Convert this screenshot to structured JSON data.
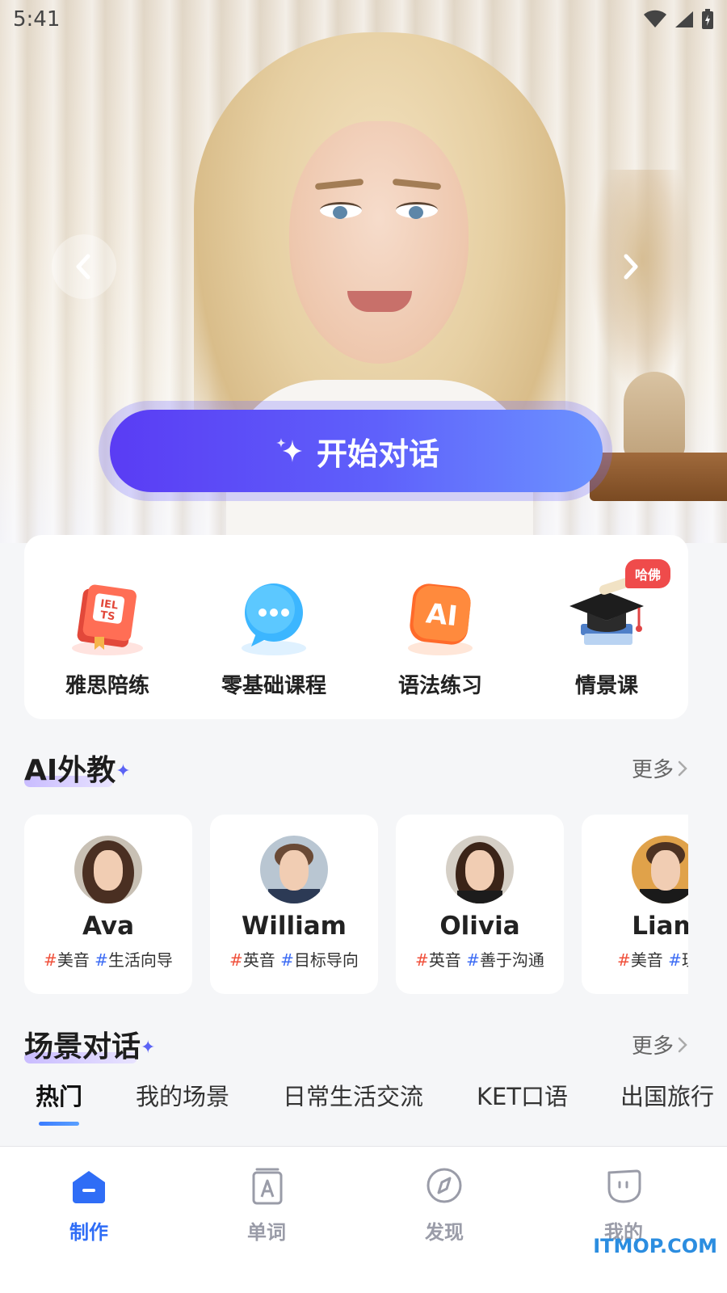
{
  "status_bar": {
    "time": "5:41"
  },
  "hero": {
    "cta_label": "开始对话"
  },
  "quick_actions": [
    {
      "label": "雅思陪练",
      "icon": "ielts-book-icon"
    },
    {
      "label": "零基础课程",
      "icon": "chat-bubble-icon"
    },
    {
      "label": "语法练习",
      "icon": "ai-icon"
    },
    {
      "label": "情景课",
      "icon": "graduation-cap-icon",
      "badge": "哈佛"
    }
  ],
  "ai_teachers": {
    "title": "AI外教",
    "more_label": "更多",
    "items": [
      {
        "name": "Ava",
        "tag1": "美音",
        "tag2": "生活向导"
      },
      {
        "name": "William",
        "tag1": "英音",
        "tag2": "目标导向"
      },
      {
        "name": "Olivia",
        "tag1": "英音",
        "tag2": "善于沟通"
      },
      {
        "name": "Liam",
        "tag1": "美音",
        "tag2": "理性"
      }
    ]
  },
  "scenes": {
    "title": "场景对话",
    "more_label": "更多",
    "tabs": [
      "热门",
      "我的场景",
      "日常生活交流",
      "KET口语",
      "出国旅行"
    ]
  },
  "bottom_nav": [
    {
      "label": "制作",
      "icon": "home-create-icon",
      "active": true
    },
    {
      "label": "单词",
      "icon": "word-card-icon",
      "active": false
    },
    {
      "label": "发现",
      "icon": "compass-icon",
      "active": false
    },
    {
      "label": "我的",
      "icon": "profile-face-icon",
      "active": false
    }
  ],
  "watermark": "ITMOP.COM",
  "colors": {
    "accent": "#5a3cf4",
    "nav_active": "#2f6df6",
    "badge": "#ef4b4b",
    "hash_red": "#f0513c",
    "hash_blue": "#3d6cf4"
  }
}
